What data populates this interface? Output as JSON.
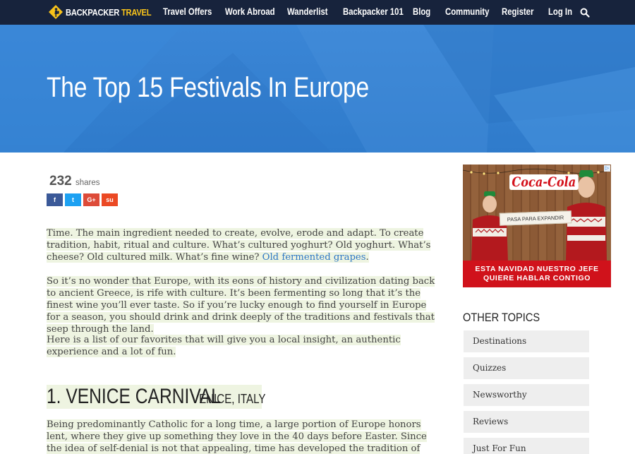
{
  "nav": {
    "logo_word1": "BACKPACKER",
    "logo_word2": "TRAVEL",
    "items": [
      "Travel Offers",
      "Work Abroad",
      "Wanderlist",
      "Backpacker 101",
      "Blog",
      "Community",
      "Register",
      "Log In"
    ],
    "search_icon": "search-icon"
  },
  "hero": {
    "title": "The Top 15 Festivals In Europe"
  },
  "shares": {
    "count": "232",
    "label": "shares",
    "buttons": [
      {
        "icon": "f",
        "color": "#3b5998"
      },
      {
        "icon": "t",
        "color": "#1da1f2"
      },
      {
        "icon": "G+",
        "color": "#dd4b39"
      },
      {
        "icon": "su",
        "color": "#eb4924"
      }
    ]
  },
  "article": {
    "p1_text": "Time. The main ingredient needed to create, evolve, erode and adapt. To create tradition, habit, ritual and culture. What’s cultured yoghurt? Old yoghurt. What’s cheese? Old cultured milk. What’s fine wine? ",
    "p1_link": "Old fermented grapes",
    "p1_end": ".",
    "p2": "So it’s no wonder that Europe, with its eons of history and civilization dating back to ancient Greece, is rife with culture. It’s been fermenting so long that it’s the finest wine you’ll ever taste. So if you’re lucky enough to find yourself in Europe for a season, you should drink and drink deeply of the traditions and festivals that seep through the land.",
    "p3": "Here is a list of our favorites that will give you a local insight, an authentic experience and a lot of fun.",
    "section_title": "1. VENICE CARNIVAL",
    "section_location": "VENICE, ITALY",
    "p4": "Being predominantly Catholic for a long time, a large portion of Europe honors lent, where they give up something they love in the 40 days before Easter. Since the idea of self-denial is not that appealing, time has developed the tradition of having one big blowout just before"
  },
  "ad": {
    "brand": "Coca-Cola",
    "sign": "PASA PARA EXPANDIR",
    "tagline_line1": "ESTA NAVIDAD NUESTRO JEFE",
    "tagline_line2": "QUIERE HABLAR CONTIGO",
    "badge": "▷"
  },
  "sidebar": {
    "heading": "OTHER TOPICS",
    "topics": [
      "Destinations",
      "Quizzes",
      "Newsworthy",
      "Reviews",
      "Just For Fun"
    ]
  },
  "colors": {
    "nav_bg": "#17233c",
    "hero_blue": "#3483d3",
    "accent_yellow": "#f7c21a",
    "highlight": "#eef4e1",
    "link": "#2e77c5",
    "ad_red": "#d0121b"
  }
}
